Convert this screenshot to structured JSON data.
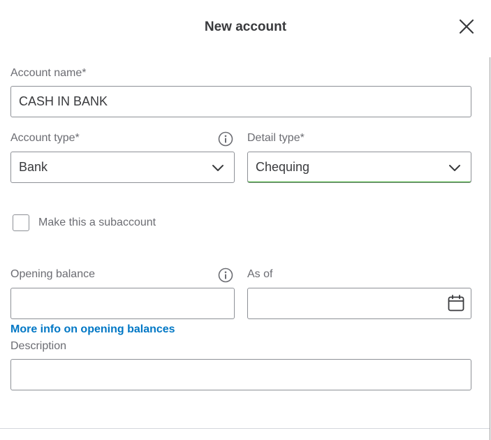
{
  "dialog": {
    "title": "New account",
    "close_icon": "close-icon"
  },
  "form": {
    "account_name": {
      "label": "Account name*",
      "value": "CASH IN BANK"
    },
    "account_type": {
      "label": "Account type*",
      "value": "Bank",
      "info_icon": "info-icon"
    },
    "detail_type": {
      "label": "Detail type*",
      "value": "Chequing"
    },
    "subaccount": {
      "label": "Make this a subaccount",
      "checked": false
    },
    "opening_balance": {
      "label": "Opening balance",
      "value": "",
      "info_icon": "info-icon"
    },
    "as_of": {
      "label": "As of",
      "value": "",
      "icon": "calendar-icon"
    },
    "opening_balance_link": "More info on opening balances",
    "description": {
      "label": "Description",
      "value": ""
    }
  },
  "colors": {
    "link": "#0077c5",
    "accent": "#2ca01c",
    "border": "#8d9096",
    "text": "#393a3d",
    "label": "#6b6c72"
  }
}
